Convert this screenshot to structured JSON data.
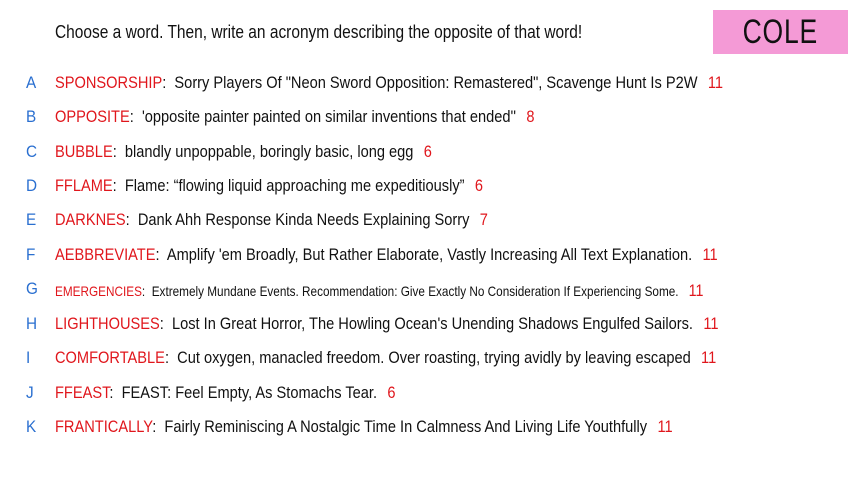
{
  "prompt": "Choose a word. Then, write an acronym describing the opposite of that word!",
  "player_name": "COLE",
  "colors": {
    "letter": "#2a6fd0",
    "word": "#e0161c",
    "count": "#e0161c",
    "badge": "#f49ad6"
  },
  "entries": [
    {
      "letter": "A",
      "word": "SPONSORSHIP",
      "acronym": "Sorry Players Of \"Neon Sword Opposition: Remastered\", Scavenge Hunt Is P2W",
      "count": "11"
    },
    {
      "letter": "B",
      "word": "OPPOSITE",
      "acronym": "'opposite painter painted on similar inventions that ended''",
      "count": "8"
    },
    {
      "letter": "C",
      "word": "BUBBLE",
      "acronym": "blandly unpoppable, boringly basic, long egg",
      "count": "6"
    },
    {
      "letter": "D",
      "word": "FFLAME",
      "acronym": "Flame: “flowing liquid approaching me expeditiously”",
      "count": "6"
    },
    {
      "letter": "E",
      "word": "DARKNES",
      "acronym": "Dank Ahh Response Kinda Needs Explaining Sorry",
      "count": "7"
    },
    {
      "letter": "F",
      "word": "AEBBREVIATE",
      "acronym": "Amplify 'em Broadly, But Rather Elaborate, Vastly Increasing All Text Explanation.",
      "count": "11"
    },
    {
      "letter": "G",
      "word": "EMERGENCIES",
      "acronym": "Extremely Mundane Events. Recommendation: Give Exactly No Consideration If Experiencing Some.",
      "count": "11"
    },
    {
      "letter": "H",
      "word": "LIGHTHOUSES",
      "acronym": "Lost In Great Horror, The Howling Ocean's Unending Shadows Engulfed Sailors.",
      "count": "11"
    },
    {
      "letter": "I",
      "word": "COMFORTABLE",
      "acronym": "Cut oxygen, manacled freedom. Over roasting, trying avidly by leaving escaped",
      "count": "11"
    },
    {
      "letter": "J",
      "word": "FFEAST",
      "acronym": "FEAST: Feel Empty, As Stomachs Tear.",
      "count": "6"
    },
    {
      "letter": "K",
      "word": "FRANTICALLY",
      "acronym": "Fairly Reminiscing A Nostalgic Time In Calmness And Living Life Youthfully",
      "count": "11"
    }
  ]
}
